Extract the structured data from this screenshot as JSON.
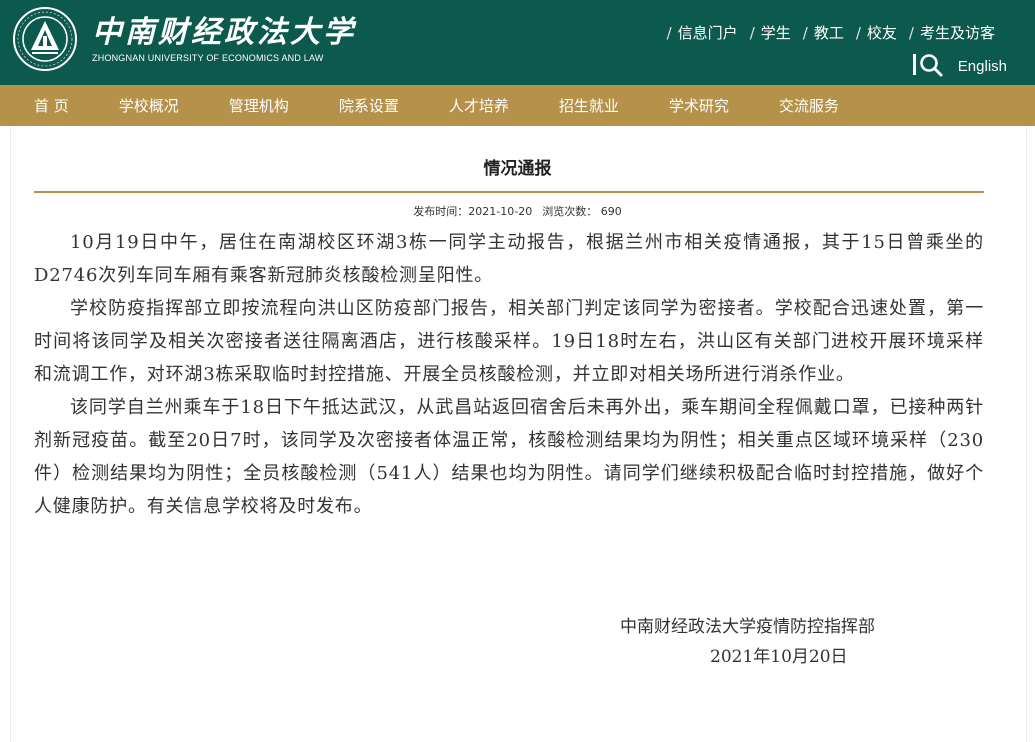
{
  "header": {
    "logo_cn": "中南财经政法大学",
    "logo_en": "ZHONGNAN UNIVERSITY OF ECONOMICS AND LAW",
    "top_links": [
      {
        "label": "信息门户"
      },
      {
        "label": "学生"
      },
      {
        "label": "教工"
      },
      {
        "label": "校友"
      },
      {
        "label": "考生及访客"
      }
    ],
    "separator": "/",
    "english_label": "English",
    "colors": {
      "header_bg": "#0c5a4e",
      "nav_bg": "#b5914a"
    }
  },
  "nav": {
    "items": [
      {
        "label": "首 页"
      },
      {
        "label": "学校概况"
      },
      {
        "label": "管理机构"
      },
      {
        "label": "院系设置"
      },
      {
        "label": "人才培养"
      },
      {
        "label": "招生就业"
      },
      {
        "label": "学术研究"
      },
      {
        "label": "交流服务"
      }
    ]
  },
  "article": {
    "title": "情况通报",
    "publish_label": "发布时间：",
    "publish_time": "2021-10-20",
    "views_label": "浏览次数：",
    "views": "690",
    "paragraphs": [
      "10月19日中午，居住在南湖校区环湖3栋一同学主动报告，根据兰州市相关疫情通报，其于15日曾乘坐的D2746次列车同车厢有乘客新冠肺炎核酸检测呈阳性。",
      "学校防疫指挥部立即按流程向洪山区防疫部门报告，相关部门判定该同学为密接者。学校配合迅速处置，第一时间将该同学及相关次密接者送往隔离酒店，进行核酸采样。19日18时左右，洪山区有关部门进校开展环境采样和流调工作，对环湖3栋采取临时封控措施、开展全员核酸检测，并立即对相关场所进行消杀作业。",
      "该同学自兰州乘车于18日下午抵达武汉，从武昌站返回宿舍后未再外出，乘车期间全程佩戴口罩，已接种两针剂新冠疫苗。截至20日7时，该同学及次密接者体温正常，核酸检测结果均为阴性；相关重点区域环境采样（230件）检测结果均为阴性；全员核酸检测（541人）结果也均为阴性。请同学们继续积极配合临时封控措施，做好个人健康防护。有关信息学校将及时发布。"
    ],
    "signature_org": "中南财经政法大学疫情防控指挥部",
    "signature_date": "2021年10月20日"
  }
}
